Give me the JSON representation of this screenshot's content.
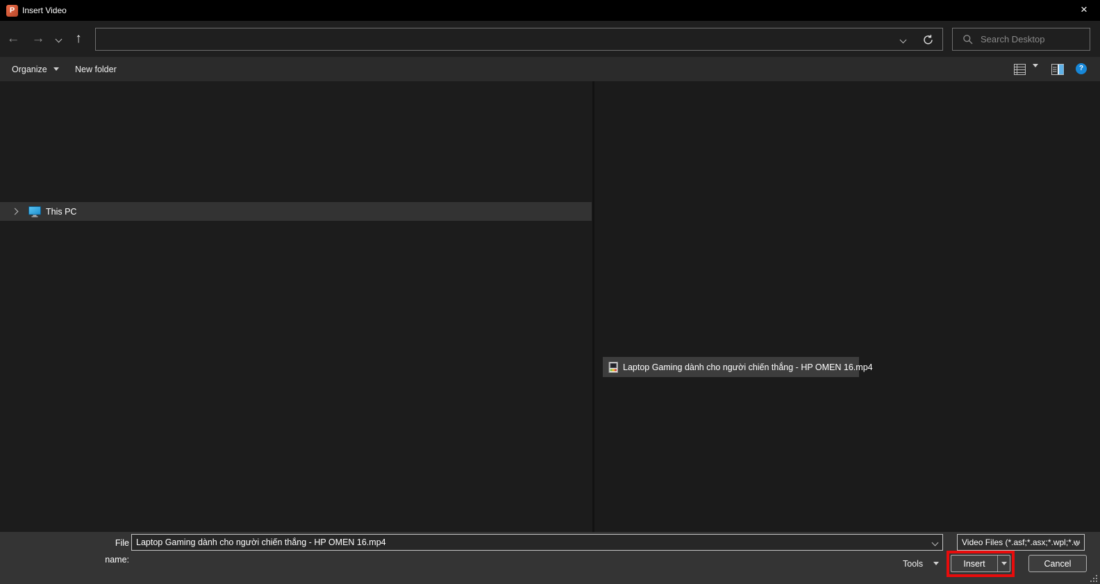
{
  "window": {
    "title": "Insert Video"
  },
  "icons": {
    "app_letter": "P",
    "close": "×",
    "back": "←",
    "forward": "→",
    "up": "↑",
    "help": "?"
  },
  "nav": {
    "address_value": "",
    "search_placeholder": "Search Desktop"
  },
  "toolbar": {
    "organize": "Organize",
    "new_folder": "New folder"
  },
  "tree": {
    "items": [
      {
        "label": "This PC"
      }
    ]
  },
  "files": {
    "selected": {
      "name": "Laptop Gaming dành cho người chiến thắng - HP OMEN 16.mp4"
    }
  },
  "footer": {
    "file_name_label": "File name:",
    "file_name_value": "Laptop Gaming dành cho người chiến thắng - HP OMEN 16.mp4",
    "file_type_value": "Video Files (*.asf;*.asx;*.wpl;*.w",
    "tools": "Tools",
    "insert": "Insert",
    "cancel": "Cancel"
  },
  "colors": {
    "annotation_red": "#e80c0c",
    "help_blue": "#1787d8",
    "monitor_blue": "#2aa5e6",
    "titlebar": "#000000",
    "pane_bg": "#1b1b1b",
    "footer_bg": "#343434"
  }
}
